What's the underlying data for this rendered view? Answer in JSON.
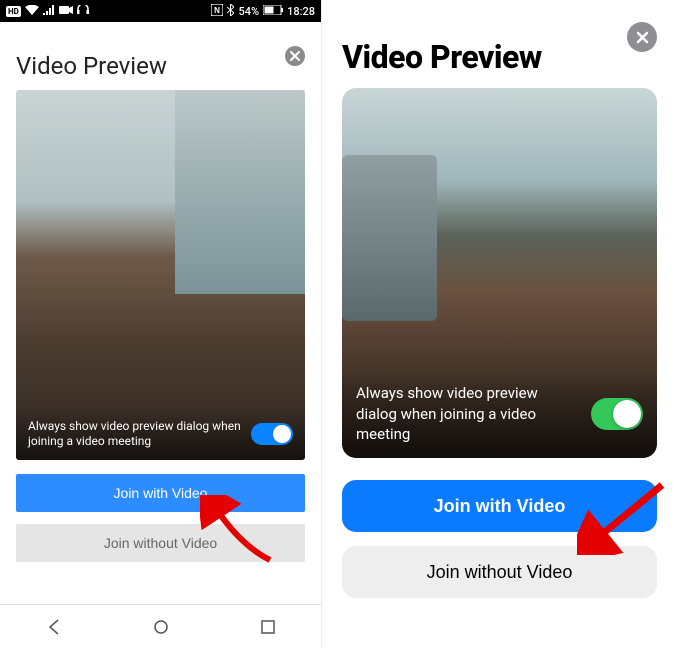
{
  "android": {
    "status": {
      "time": "18:28",
      "battery_pct": "54%",
      "nfc": "N",
      "bt": true
    },
    "title": "Video Preview",
    "overlay_text": "Always show video preview dialog when joining a video meeting",
    "toggle_on": true,
    "join_with_video": "Join with Video",
    "join_without_video": "Join without Video"
  },
  "ios": {
    "title": "Video Preview",
    "overlay_text": "Always show video preview dialog when joining a video meeting",
    "toggle_on": true,
    "join_with_video": "Join with Video",
    "join_without_video": "Join without Video"
  }
}
